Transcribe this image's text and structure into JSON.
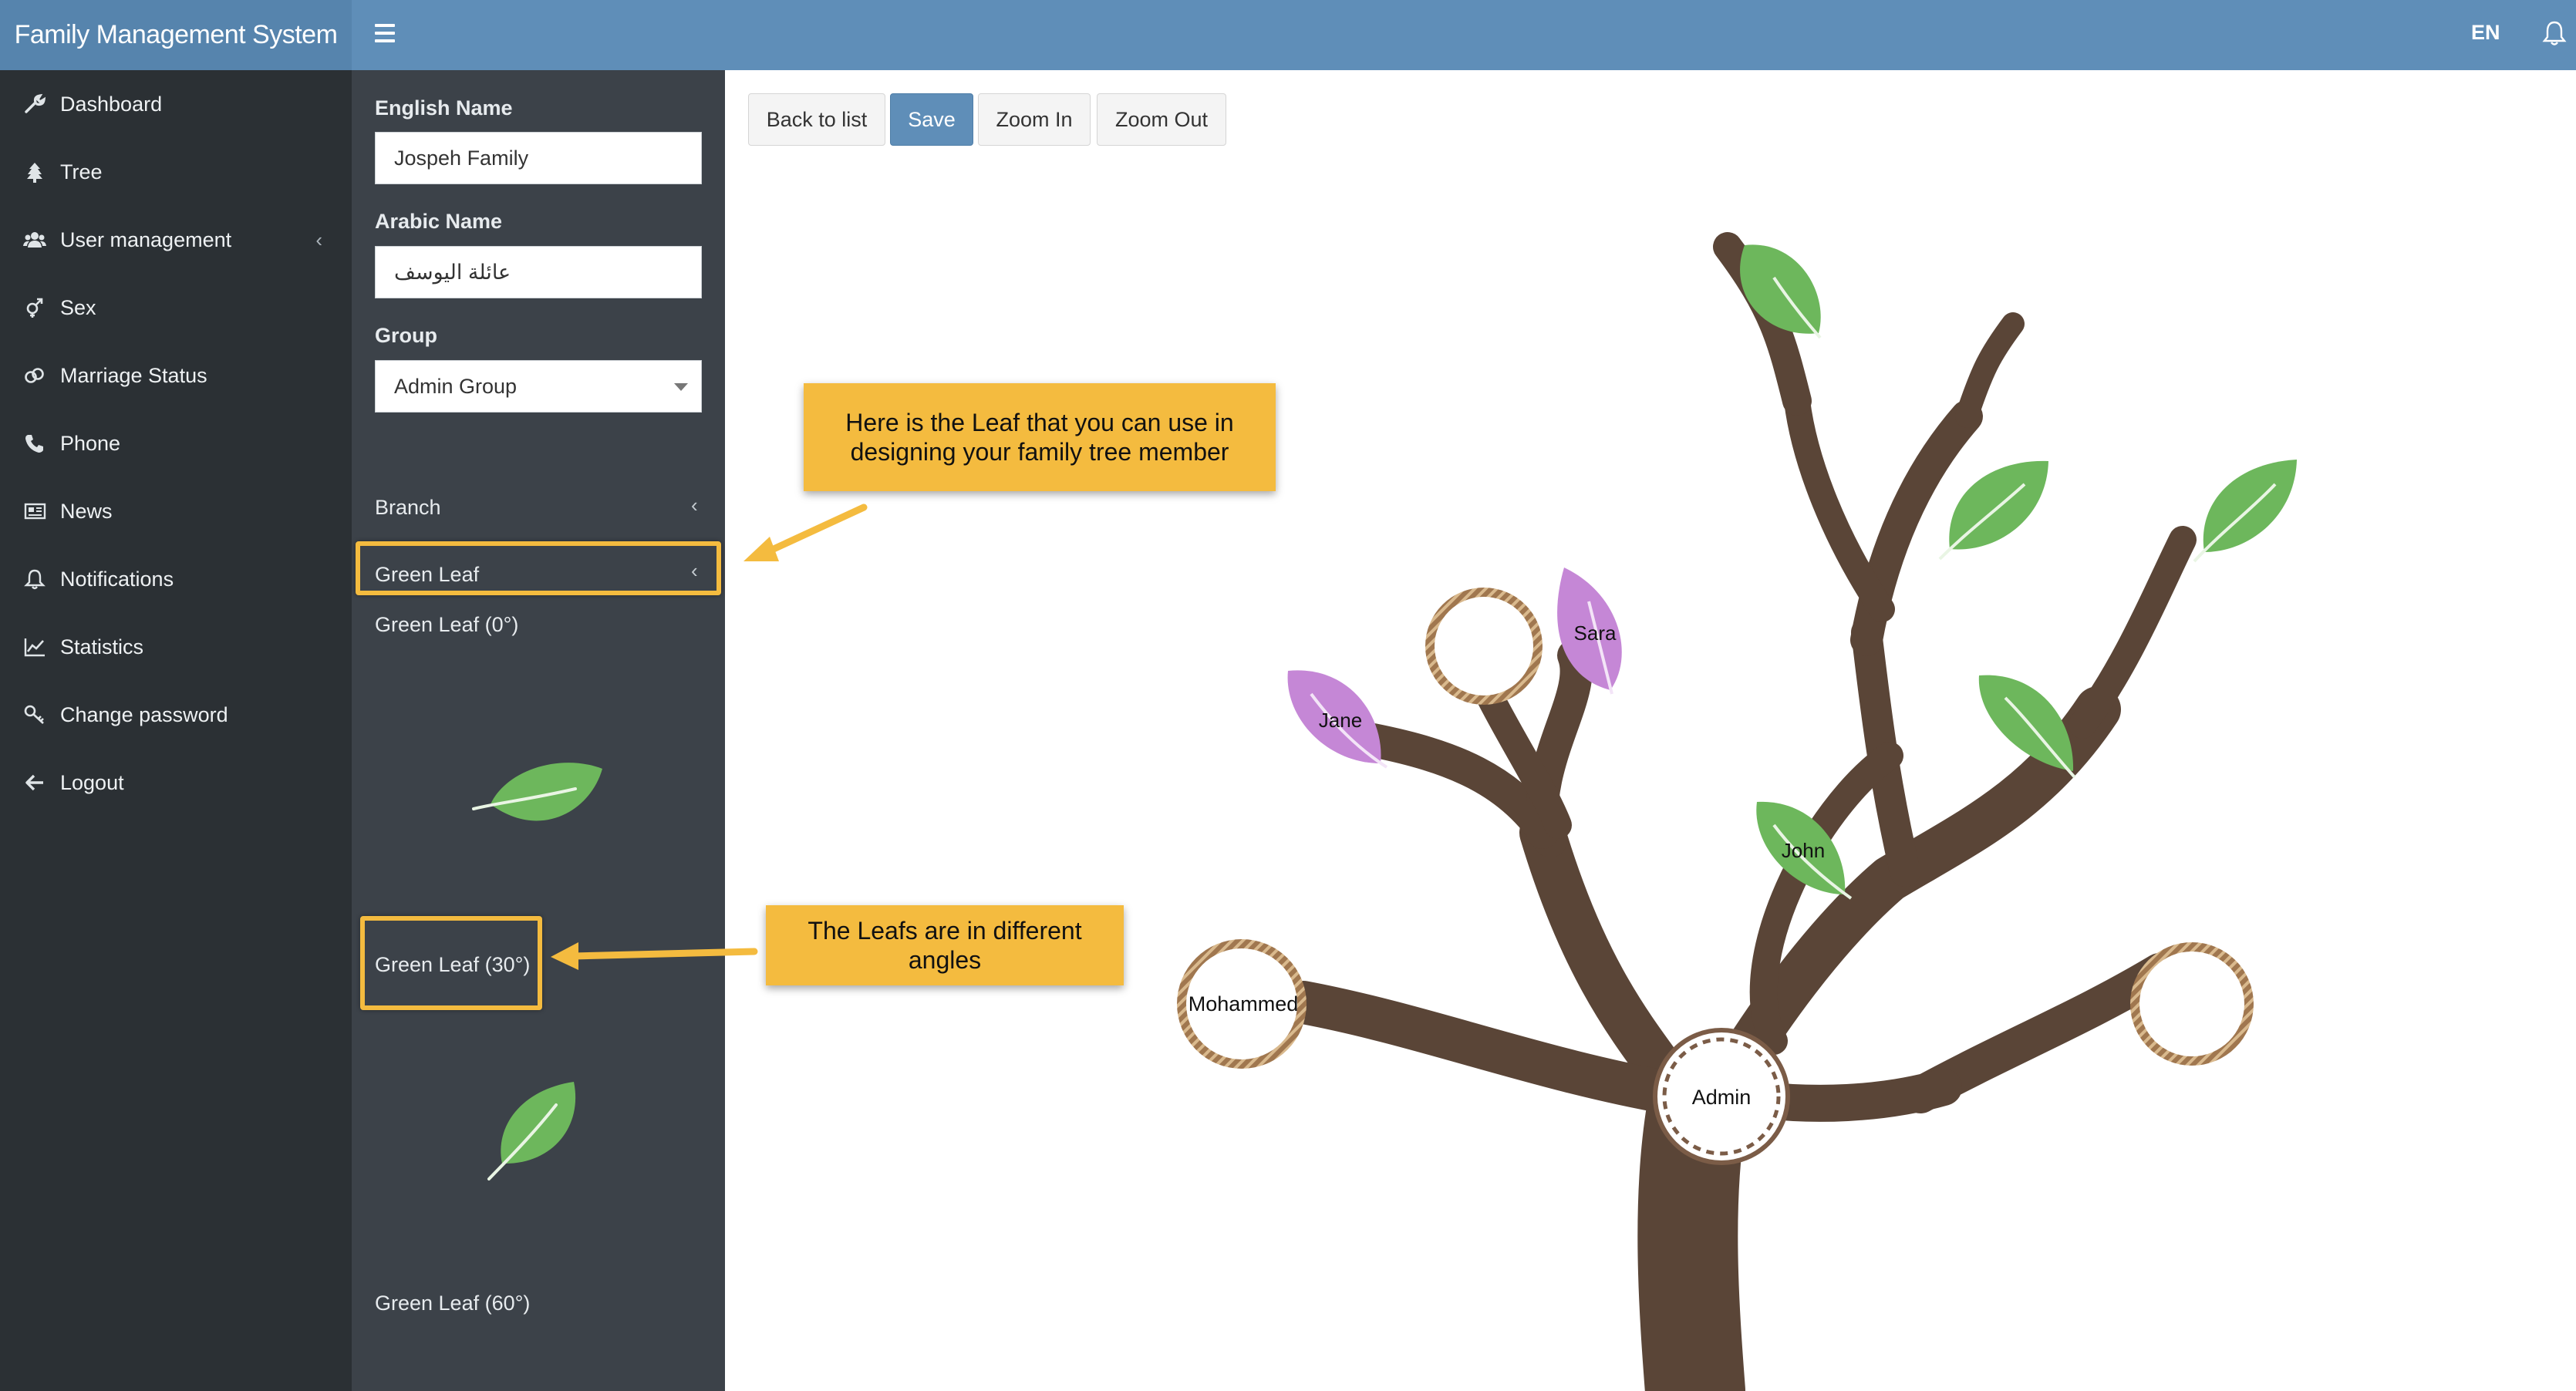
{
  "app": {
    "title": "Family Management System",
    "language": "EN"
  },
  "nav": {
    "items": [
      {
        "label": "Dashboard",
        "icon": "wrench-icon"
      },
      {
        "label": "Tree",
        "icon": "tree-icon"
      },
      {
        "label": "User management",
        "icon": "users-icon",
        "chevron": "‹"
      },
      {
        "label": "Sex",
        "icon": "gender-icon"
      },
      {
        "label": "Marriage Status",
        "icon": "rings-icon"
      },
      {
        "label": "Phone",
        "icon": "phone-icon"
      },
      {
        "label": "News",
        "icon": "newspaper-icon"
      },
      {
        "label": "Notifications",
        "icon": "bell-icon"
      },
      {
        "label": "Statistics",
        "icon": "chart-icon"
      },
      {
        "label": "Change password",
        "icon": "key-icon"
      },
      {
        "label": "Logout",
        "icon": "arrow-left-icon"
      }
    ]
  },
  "form": {
    "english_name": {
      "label": "English Name",
      "value": "Jospeh Family"
    },
    "arabic_name": {
      "label": "Arabic Name",
      "value": "عائلة اليوسف"
    },
    "group": {
      "label": "Group",
      "value": "Admin Group"
    }
  },
  "palette": {
    "branch": "Branch",
    "green_leaf": "Green Leaf",
    "chevron": "‹",
    "leaf0": "Green Leaf (0°)",
    "leaf30": "Green Leaf (30°)",
    "leaf60": "Green Leaf (60°)"
  },
  "toolbar": {
    "back": "Back to list",
    "save": "Save",
    "zoom_in": "Zoom In",
    "zoom_out": "Zoom Out"
  },
  "callouts": {
    "leaf_line1": "Here is the Leaf that you can use in",
    "leaf_line2": "designing your family tree member",
    "angles_line1": "The Leafs are in different",
    "angles_line2": "angles"
  },
  "tree": {
    "members": {
      "admin": "Admin",
      "mohammed": "Mohammed",
      "jane": "Jane",
      "sara": "Sara",
      "john": "John"
    }
  },
  "colors": {
    "topbar": "#5f8eb8",
    "sidebar": "#2b3034",
    "panel": "#3c4249",
    "primary_button": "#5f8eb8",
    "callout": "#f4bb3f",
    "green_leaf": "#6db75c",
    "purple_leaf": "#c587d6",
    "trunk": "#5a4537"
  }
}
